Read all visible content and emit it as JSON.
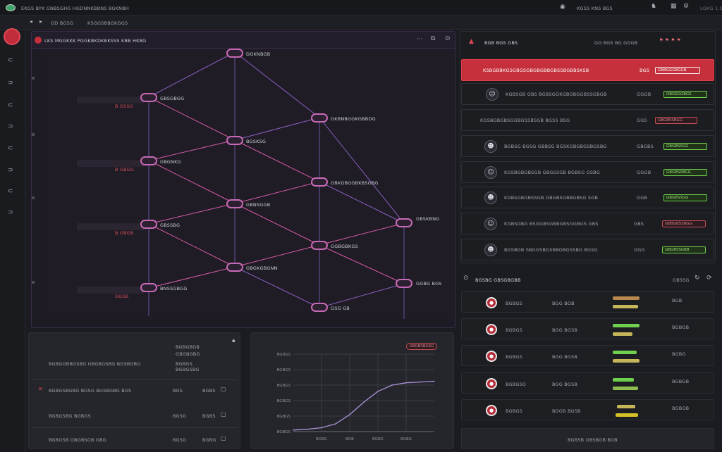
{
  "topbar": {
    "title": "EKGS BYK GNBSGHG HGDNNKBBNS BGKNBH",
    "center": "KGSS KNS BGS",
    "right": "LGKG 1:S"
  },
  "subbar": {
    "items": [
      "GD BGSG",
      "KSGGSBBGKGGS"
    ]
  },
  "graph": {
    "title": "LKS MGGKKK PGGKBKDKBKSSS KBB HKBG",
    "nodes": [
      {
        "label": "DGKNBGB"
      },
      {
        "label": "GBSGBGG"
      },
      {
        "label": "GKBNBGGKGBBDG"
      },
      {
        "label": "BGSKSG"
      },
      {
        "label": "GBGNKG"
      },
      {
        "label": "GBKGBGGBKBSGBG"
      },
      {
        "label": "GBNSGGB"
      },
      {
        "label": "GBSSBG"
      },
      {
        "label": "GBSKBNG"
      },
      {
        "label": "GGBGBKGS"
      },
      {
        "label": "GBGKGBGNN"
      },
      {
        "label": "BNSSGBGG"
      },
      {
        "label": "GGBG BGS"
      },
      {
        "label": "GSG GB"
      }
    ],
    "side_labels": [
      "B GSSG",
      "B GBGG",
      "B GBGB",
      "GGSB"
    ]
  },
  "incidents": {
    "header": "BGB BGS GBS",
    "header_right": [
      "GG BGS BG GGGB"
    ],
    "rows": [
      {
        "text": "KSBGBBKGSGBGSGBGBGBBGBSSBGBBSKSB",
        "time": "BGS",
        "status": "GBBGGGBGGB",
        "kind": "alert"
      },
      {
        "text": "KGBSGB GBS BGBSGGKGBGBGGBSSGBGB",
        "time": "GGGB",
        "status": "GBGSGGBGS",
        "kind": "ok"
      },
      {
        "text": "KGSBGBGBSGGBGSSBSGB BGSS BSG",
        "time": "GGS",
        "status": "GBGBSSBGG",
        "kind": "bad"
      },
      {
        "text": "BGBSG BGSG GBBSG BGSKGBGBGSBGSBG",
        "time": "GBGBS",
        "status": "GBGBSSGG",
        "kind": "ok"
      },
      {
        "text": "KGSBGBGBSGB GBGSSGB BGBSG GSBG",
        "time": "GGGB",
        "status": "GBGBSSBGG",
        "kind": "ok"
      },
      {
        "text": "KGBSGBGBSSGB GBGBSGBBGBSG SGB",
        "time": "GGB",
        "status": "GBGBSSGG",
        "kind": "ok"
      },
      {
        "text": "KGBSGBG BSGGBSGBBGBSGGBGS GBS",
        "time": "GBS",
        "status": "GBBGBSSBGG",
        "kind": "bad"
      },
      {
        "text": "BGSBGB SBGGSBGSBBGBGSSBG BGSG",
        "time": "GGG",
        "status": "GBGBSSGBB",
        "kind": "ok"
      }
    ]
  },
  "agents": {
    "header": "BGSBG GBSGBGBB",
    "header_right": "GBSSG",
    "rows": [
      {
        "name": "BGBGS",
        "role": "BGG BGB",
        "meta": "BGB"
      },
      {
        "name": "BGBGS",
        "role": "BGG BGSB",
        "meta": "BGBGB"
      },
      {
        "name": "BGBGS",
        "role": "BGG BGSB",
        "meta": "BGBG"
      },
      {
        "name": "BGBGSG",
        "role": "BGG BGSB",
        "meta": "BGBGB"
      },
      {
        "name": "BGBGS",
        "role": "BGGB BGSB",
        "meta": "BGBGB"
      }
    ],
    "footer": "BGBSB GBSBGB BGB"
  },
  "log": {
    "head": "BGBGBGB",
    "head2": "GBGBGBG",
    "rows": [
      {
        "text": "BGBGGBBGSBG GBGBGSBG BGSBGBG",
        "a": "BGBGS",
        "b": "BGBGSBG"
      },
      {
        "text": "BGBGSBGBG BGSG BGSBGBG BGS",
        "a": "BGS",
        "b": "BGBS"
      },
      {
        "text": "BGBGSBG BGBGS",
        "a": "BGSG",
        "b": "BGBS"
      },
      {
        "text": "BGBGSB GBGBSGB GBG",
        "a": "BGSG",
        "b": "BGBG"
      }
    ]
  },
  "chart_data": {
    "type": "line",
    "title": "GBGBSBGSG",
    "ytick_labels": [
      "BGBGS",
      "BGBGS",
      "BGBGS",
      "BGBGS",
      "BGBGS",
      "BGBGS"
    ],
    "xtick_labels": [
      "BGBG",
      "BGB",
      "BGBG",
      "BGBG"
    ],
    "x": [
      0,
      1,
      2,
      3,
      4,
      5,
      6,
      7,
      8,
      9,
      10
    ],
    "series": [
      {
        "values": [
          0.02,
          0.03,
          0.05,
          0.1,
          0.22,
          0.38,
          0.52,
          0.6,
          0.63,
          0.64,
          0.65
        ]
      }
    ],
    "ylim": [
      0,
      1
    ]
  },
  "colors": {
    "accent": "#c5303c",
    "edge": "#8b5fc2",
    "edge_pink": "#d95aa8",
    "ok": "#6fcf4f"
  }
}
